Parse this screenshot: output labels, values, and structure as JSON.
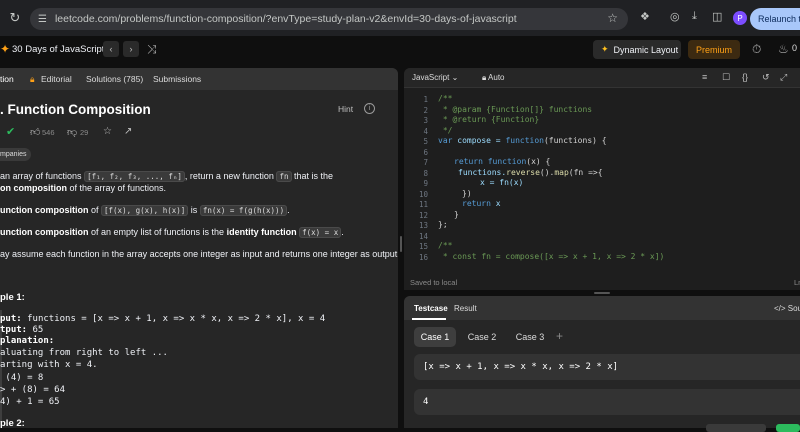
{
  "browser": {
    "url": "leetcode.com/problems/function-composition/?envType=study-plan-v2&envId=30-days-of-javascript",
    "relaunch_label": "Relaunch to u",
    "avatar_letter": "P"
  },
  "topbar": {
    "study_plan_title": "30 Days of JavaScript",
    "dynamic_layout_label": "Dynamic Layout",
    "premium_label": "Premium",
    "streak_count": "0"
  },
  "left_tabs": {
    "description": "tion",
    "editorial": "Editorial",
    "solutions": "Solutions (785)",
    "submissions": "Submissions"
  },
  "problem": {
    "title": ". Function Composition",
    "hint_label": "Hint",
    "likes": "546",
    "dislikes": "29",
    "tag": "mpanies",
    "p1_a": "an array of functions",
    "p1_code1": "[f₁, f₂, f₃, ..., fₙ]",
    "p1_b": ", return a new function",
    "p1_code2": "fn",
    "p1_c": "that is the",
    "p1_line2_bold": "on composition",
    "p1_line2_rest": " of the array of functions.",
    "p2_bold": "unction composition",
    "p2_of": " of ",
    "p2_code1": "[f(x), g(x), h(x)]",
    "p2_is": " is ",
    "p2_code2": "fn(x) = f(g(h(x)))",
    "p2_end": ".",
    "p3_bold": "unction composition",
    "p3_rest": " of an empty list of functions is the ",
    "p3_bold2": "identity function",
    "p3_code": "f(x) = x",
    "p3_end": ".",
    "p4": "ay assume each function in the array accepts one integer as input and returns one integer as output.",
    "example1_heading": "ple 1:",
    "ex1_input_label": "put:",
    "ex1_input_val": " functions = [x => x + 1, x => x * x, x => 2 * x], x = 4",
    "ex1_output_label": "tput:",
    "ex1_output_val": " 65",
    "ex1_expl_label": "planation:",
    "ex1_l1": "aluating from right to left ...",
    "ex1_l2": "arting with x = 4.",
    "ex1_l3": " (4) = 8",
    "ex1_l4": "> + (8) = 64",
    "ex1_l5": "4) + 1 = 65",
    "example2_heading": "ple 2:"
  },
  "editor": {
    "language": "JavaScript",
    "mode": "Auto",
    "line_numbers": [
      "1",
      "2",
      "3",
      "4",
      "5",
      "6",
      "7",
      "8",
      "9",
      "10",
      "11",
      "12",
      "13",
      "14",
      "15",
      "16"
    ],
    "lines": {
      "l1": "/**",
      "l2": " * @param {Function[]} functions",
      "l3": " * @return {Function}",
      "l4": " */",
      "l5_kw": "var",
      "l5_a": " compose = ",
      "l5_kw2": "function",
      "l5_b": "(functions) {",
      "l6": "",
      "l7_kw": "return",
      "l7_fn": " function",
      "l7_b": "(x) {",
      "l8_a": "functions.",
      "l8_fn": "reverse",
      "l8_b": "().",
      "l8_fn2": "map",
      "l8_c": "(fn =>{",
      "l9": "x = fn(x)",
      "l10": "})",
      "l11_kw": "return",
      "l11_b": " x",
      "l12": "}",
      "l13": "};",
      "l14": "",
      "l15": "/**",
      "l16": " * const fn = compose([x => x + 1, x => 2 * x])"
    },
    "saved_label": "Saved to local",
    "cursor_pos": "Ln"
  },
  "testcase": {
    "tab_testcase": "Testcase",
    "tab_result": "Result",
    "source_label": "Sourc",
    "cases": [
      "Case 1",
      "Case 2",
      "Case 3"
    ],
    "plus": "+",
    "input_functions": "[x => x + 1, x => x * x, x => 2 * x]",
    "input_x": "4"
  },
  "colors": {
    "accent_premium": "#ffa116",
    "success_green": "#2cbb5d"
  }
}
